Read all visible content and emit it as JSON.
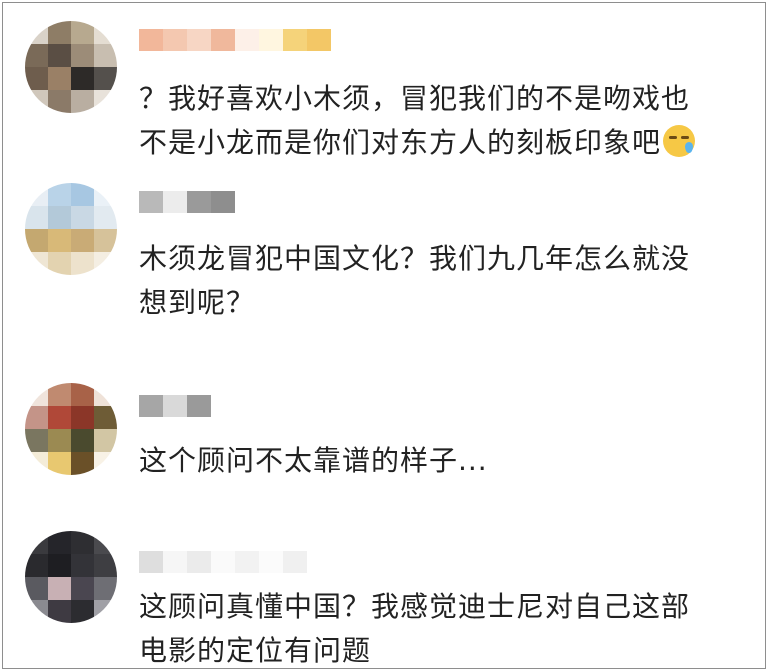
{
  "comments": [
    {
      "text": "？我好喜欢小木须，冒犯我们的不是吻戏也\n不是小龙而是你们对东方人的刻板印象吧",
      "emoji": "sweat-smile-emoji"
    },
    {
      "text": "木须龙冒犯中国文化？我们九几年怎么就没\n想到呢？"
    },
    {
      "text": "这个顾问不太靠谱的样子..."
    },
    {
      "text": "这顾问真懂中国？我感觉迪士尼对自己这部\n电影的定位有问题"
    }
  ]
}
